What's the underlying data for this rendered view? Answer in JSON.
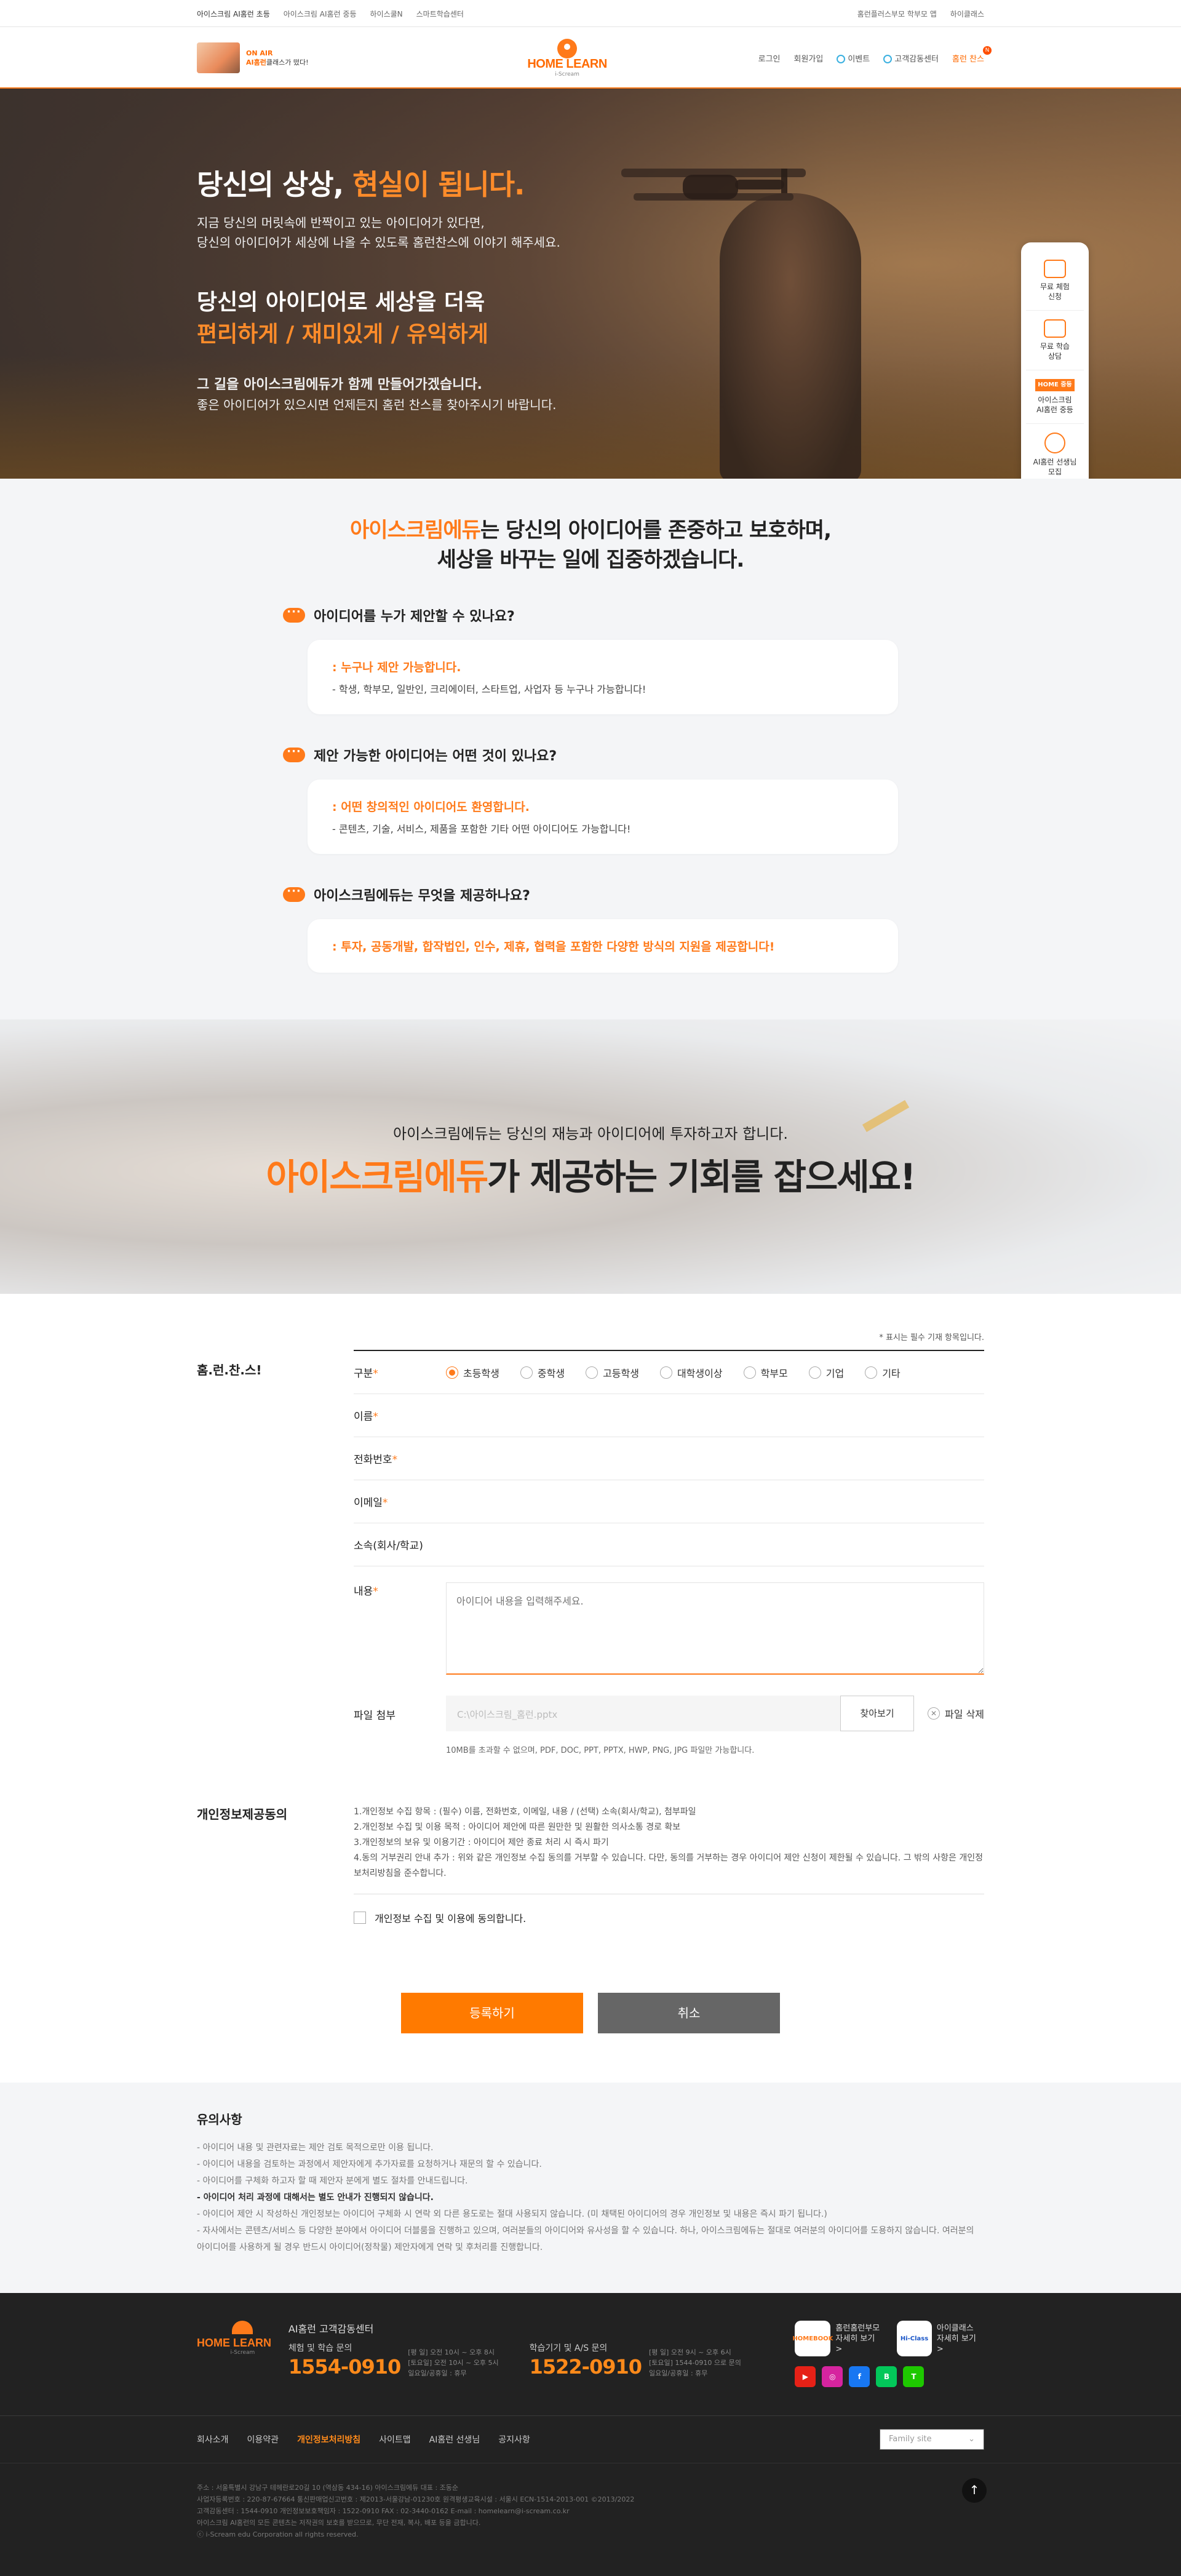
{
  "topbar": {
    "left": [
      "아이스크림 AI홈런 초등",
      "아이스크림 AI홈런 중등",
      "하이스쿨N",
      "스마트학습센터"
    ],
    "right": [
      "홈런플러스부모 학부모 앱",
      "하이클래스"
    ]
  },
  "header": {
    "promo_new": "ON AIR",
    "promo_line1": "AI홈런",
    "promo_line2": "클래스가 떴다!",
    "logo_name": "HOME LEARN",
    "logo_sub": "i-Scream",
    "nav": [
      "로그인",
      "회원가입",
      "이벤트",
      "고객감동센터",
      "홈런 찬스"
    ],
    "nav_badge": "N"
  },
  "hero": {
    "title_plain": "당신의 상상, ",
    "title_accent": "현실이 됩니다.",
    "desc1": "지금 당신의 머릿속에 반짝이고 있는 아이디어가 있다면,",
    "desc2": "당신의 아이디어가 세상에 나올 수 있도록 홈런찬스에 이야기 해주세요.",
    "sub_title": "당신의 아이디어로 세상을 더욱",
    "sub_accent": "편리하게 / 재미있게 / 유익하게",
    "close_bold": "그 길을 아이스크림에듀가 함께 만들어가겠습니다.",
    "close_text": "좋은 아이디어가 있으시면 언제든지 홈런 찬스를 찾아주시기 바랍니다."
  },
  "quick": {
    "items": [
      {
        "l1": "무료 체험",
        "l2": "신청"
      },
      {
        "l1": "무료 학습",
        "l2": "상담"
      },
      {
        "logo": "HOME 중등",
        "l1": "아이스크림",
        "l2": "AI홈런 중등"
      },
      {
        "l1": "AI홈런 선생님",
        "l2": "모집"
      }
    ]
  },
  "intro": {
    "accent": "아이스크림에듀",
    "title1": "는 당신의 아이디어를 존중하고 보호하며,",
    "title2": "세상을 바꾸는 일에 집중하겠습니다.",
    "faq": [
      {
        "q": "아이디어를 누가 제안할 수 있나요?",
        "h": ": 누구나 제안 가능합니다.",
        "d": "- 학생, 학부모, 일반인, 크리에이터, 스타트업, 사업자 등 누구나 가능합니다!"
      },
      {
        "q": "제안 가능한 아이디어는 어떤 것이 있나요?",
        "h": ": 어떤 창의적인 아이디어도 환영합니다.",
        "d": "- 콘텐츠, 기술, 서비스, 제품을 포함한 기타 어떤 아이디어도 가능합니다!"
      },
      {
        "q": "아이스크림에듀는 무엇을 제공하나요?",
        "h": ": 투자, 공동개발, 합작법인, 인수, 제휴, 협력을 포함한 다양한 방식의 지원을 제공합니다!",
        "d": ""
      }
    ]
  },
  "banner": {
    "sub": "아이스크림에듀는 당신의 재능과 아이디어에 투자하고자 합니다.",
    "accent": "아이스크림에듀",
    "main": "가 제공하는 기회를 잡으세요!"
  },
  "form": {
    "side_title": "홈.런.찬.스!",
    "required_note": "* 표시는 필수 기재 항목입니다.",
    "type_label": "구분",
    "types": [
      "초등학생",
      "중학생",
      "고등학생",
      "대학생이상",
      "학부모",
      "기업",
      "기타"
    ],
    "name_label": "이름",
    "phone_label": "전화번호",
    "email_label": "이메일",
    "org_label": "소속(회사/학교)",
    "content_label": "내용",
    "content_placeholder": "아이디어 내용을 입력해주세요.",
    "file_label": "파일 첨부",
    "file_placeholder": "C:\\아이스크림_홈런.pptx",
    "file_button": "찾아보기",
    "file_delete": "파일 삭제",
    "file_note": "10MB를 초과할 수 없으며, PDF, DOC, PPT, PPTX, HWP, PNG, JPG 파일만 가능합니다.",
    "star": "*"
  },
  "privacy": {
    "title": "개인정보제공동의",
    "items": [
      "1.개인정보 수집 항목 : (필수) 이름, 전화번호, 이메일, 내용 / (선택) 소속(회사/학교), 첨부파일",
      "2.개인정보 수집 및 이용 목적 : 아이디어 제안에 따른 원만한 및 원활한 의사소통 경로 확보",
      "3.개인정보의 보유 및 이용기간 : 아이디어 제안 종료 처리 시 즉시 파기",
      "4.동의 거부권리 안내 추가 : 위와 같은 개인정보 수집 동의를 거부할 수 있습니다. 다만, 동의를 거부하는 경우 아이디어 제안 신청이 제한될 수 있습니다. 그 밖의 사항은 개인정보처리방침을 준수합니다."
    ],
    "agree": "개인정보 수집 및 이용에 동의합니다."
  },
  "actions": {
    "submit": "등록하기",
    "cancel": "취소"
  },
  "notice": {
    "title": "유의사항",
    "items": [
      "- 아이디어 내용 및 관련자료는 제안 검토 목적으로만 이용 됩니다.",
      "- 아이디어 내용을 검토하는 과정에서 제안자에게 추가자료를 요청하거나 재문의 할 수 있습니다.",
      "- 아이디어를 구체화 하고자 할 때 제안자 분에게 별도 절차를 안내드립니다.",
      "- 아이디어 처리 과정에 대해서는 별도 안내가 진행되지 않습니다.",
      "- 아이디어 제안 시 작성하신 개인정보는 아이디어 구체화 시 연락 외 다른 용도로는 절대 사용되지 않습니다. (미 채택된 아이디어의 경우 개인정보 및 내용은 즉시 파기 됩니다.)",
      "- 자사에서는 콘텐츠/서비스 등 다양한 분야에서 아이디어 더블룸을 진행하고 있으며, 여러분들의 아이디어와 유사성을 할 수 있습니다. 하나, 아이스크림에듀는 절대로 여러분의 아이디어를 도용하지 않습니다. 여러분의 아이디어를 사용하게 될 경우 반드시 아이디어(정착물) 제안자에게 연락 및 후처리를 진행합니다."
    ],
    "strong_index": 3
  },
  "footer": {
    "logo": "HOME LEARN",
    "logo_sub": "i-Scream",
    "cs_title": "AI홈런 고객감동센터",
    "cols": [
      {
        "t": "체험 및 학습 문의",
        "num": "1554-0910",
        "h1": "[평 일] 오전 10시 ~ 오후 8시",
        "h2": "[토요일] 오전 10시 ~ 오후 5시",
        "h3": "일요일/공휴일 : 휴무"
      },
      {
        "t": "학습기기 및 A/S 문의",
        "num": "1522-0910",
        "h1": "[평 일] 오전 9시 ~ 오후 6시",
        "h2": "[토요일] 1544-0910 으로 문의",
        "h3": "일요일/공휴일 : 휴무"
      }
    ],
    "apps": [
      {
        "ic": "HOMEBOOK",
        "l1": "홈런홈런부모",
        "l2": "자세히 보기 >"
      },
      {
        "ic": "Hi-Class",
        "l1": "아이클래스",
        "l2": "자세히 보기 >"
      }
    ],
    "sns": [
      "▶",
      "◎",
      "f",
      "B",
      "T"
    ],
    "links": [
      "회사소개",
      "이용약관",
      "개인정보처리방침",
      "사이트맵",
      "AI홈런 선생님",
      "공지사항"
    ],
    "family": "Family site",
    "info": [
      "주소 : 서울특별시 강남구 테헤란로20길 10 (역삼동 434-16) 아이스크림에듀    대표 : 조동순",
      "사업자등록번호 : 220-87-67664   통신판매업신고번호 : 제2013-서울강남-01230호   원격평생교육시설 : 서울시 ECN-1514-2013-001 ©2013/2022",
      "고객감동센터 : 1544-0910   개인정보보호책임자 : 1522-0910   FAX : 02-3440-0162   E-mail : homelearn@i-scream.co.kr",
      "아이스크림 AI홈런의 모든 콘텐츠는 저작권의 보호를 받으므로, 무단 전재, 복사, 배포 등을 금합니다.",
      "ⓒ i-Scream edu Corporation all rights reserved."
    ],
    "top": "↑"
  },
  "colors": {
    "accent": "#ff7a1a",
    "dark": "#222222"
  }
}
